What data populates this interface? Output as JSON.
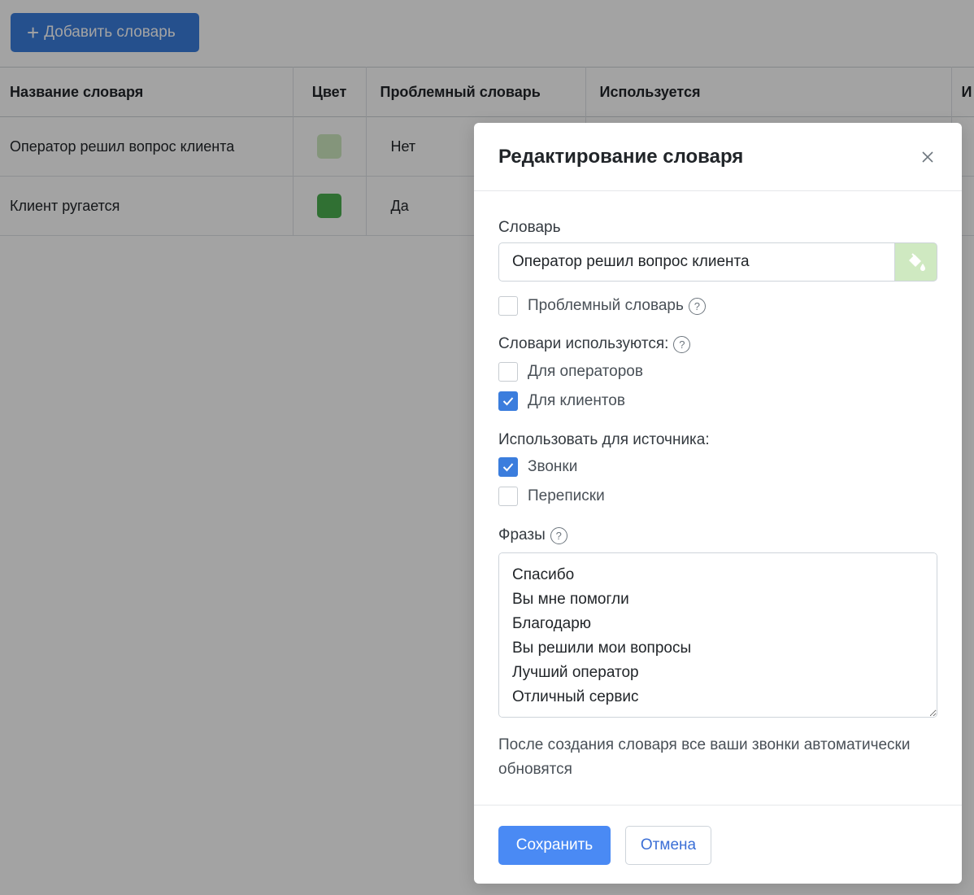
{
  "toolbar": {
    "add_label": "Добавить словарь"
  },
  "table": {
    "columns": [
      "Название словаря",
      "Цвет",
      "Проблемный словарь",
      "Используется",
      "И"
    ],
    "rows": [
      {
        "name": "Оператор решил вопрос клиента",
        "color": "#cfe9c1",
        "problem": "Нет"
      },
      {
        "name": "Клиент ругается",
        "color": "#4caf50",
        "problem": "Да"
      }
    ]
  },
  "modal": {
    "title": "Редактирование словаря",
    "dict_label": "Словарь",
    "dict_value": "Оператор решил вопрос клиента",
    "dict_color": "#cfe9c1",
    "problem_label": "Проблемный словарь",
    "problem_checked": false,
    "used_label": "Словари используются:",
    "used_options": [
      {
        "label": "Для операторов",
        "checked": false
      },
      {
        "label": "Для клиентов",
        "checked": true
      }
    ],
    "source_label": "Использовать для источника:",
    "source_options": [
      {
        "label": "Звонки",
        "checked": true
      },
      {
        "label": "Переписки",
        "checked": false
      }
    ],
    "phrases_label": "Фразы",
    "phrases": "Спасибо\nВы мне помогли\nБлагодарю\nВы решили мои вопросы\nЛучший оператор\nОтличный сервис",
    "note": "После создания словаря все ваши звонки автоматически обновятся",
    "save_label": "Сохранить",
    "cancel_label": "Отмена"
  },
  "colors": {
    "primary": "#3b7ddd",
    "save_button": "#4a8af4"
  }
}
